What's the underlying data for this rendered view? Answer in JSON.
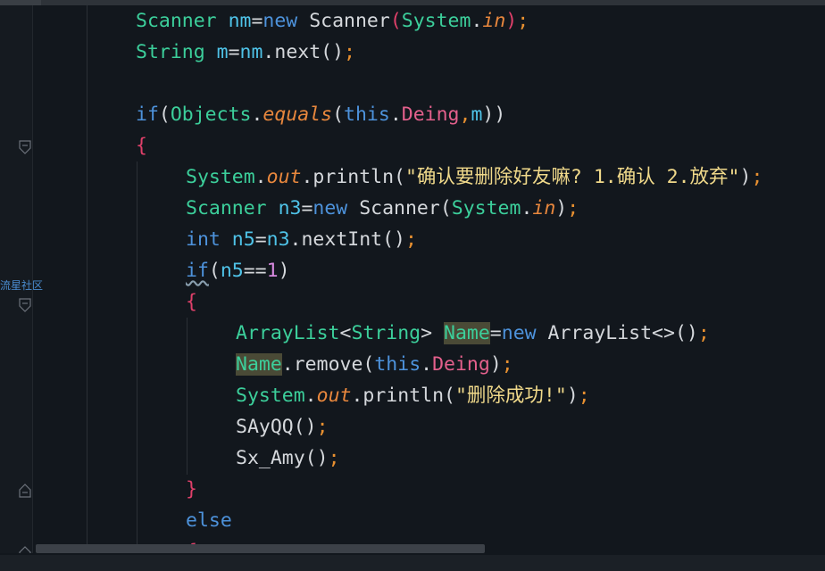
{
  "watermark": "流星社区",
  "code_lines": [
    [
      {
        "t": "    ",
        "c": "pn"
      },
      {
        "t": "Scanner",
        "c": "ty"
      },
      {
        "t": " ",
        "c": "pn"
      },
      {
        "t": "nm",
        "c": "var"
      },
      {
        "t": "=",
        "c": "pn"
      },
      {
        "t": "new",
        "c": "kw"
      },
      {
        "t": " ",
        "c": "pn"
      },
      {
        "t": "Scanner",
        "c": "pn"
      },
      {
        "t": "(",
        "c": "par1"
      },
      {
        "t": "System",
        "c": "ty"
      },
      {
        "t": ".",
        "c": "pn"
      },
      {
        "t": "in",
        "c": "st"
      },
      {
        "t": ")",
        "c": "par1"
      },
      {
        "t": ";",
        "c": "semi"
      }
    ],
    [
      {
        "t": "    ",
        "c": "pn"
      },
      {
        "t": "String",
        "c": "ty"
      },
      {
        "t": " ",
        "c": "pn"
      },
      {
        "t": "m",
        "c": "var"
      },
      {
        "t": "=",
        "c": "pn"
      },
      {
        "t": "nm",
        "c": "var"
      },
      {
        "t": ".",
        "c": "pn"
      },
      {
        "t": "next",
        "c": "pn"
      },
      {
        "t": "()",
        "c": "pn"
      },
      {
        "t": ";",
        "c": "semi"
      }
    ],
    [],
    [
      {
        "t": "    ",
        "c": "pn"
      },
      {
        "t": "if",
        "c": "kw"
      },
      {
        "t": "(",
        "c": "pn"
      },
      {
        "t": "Objects",
        "c": "ty"
      },
      {
        "t": ".",
        "c": "pn"
      },
      {
        "t": "equals",
        "c": "st"
      },
      {
        "t": "(",
        "c": "pn"
      },
      {
        "t": "this",
        "c": "kw"
      },
      {
        "t": ".",
        "c": "pn"
      },
      {
        "t": "Deing",
        "c": "fld"
      },
      {
        "t": ",",
        "c": "semi"
      },
      {
        "t": "m",
        "c": "var"
      },
      {
        "t": "))",
        "c": "pn"
      }
    ],
    [
      {
        "t": "    ",
        "c": "pn"
      },
      {
        "t": "{",
        "c": "brace"
      }
    ],
    [
      {
        "t": "        ",
        "c": "pn"
      },
      {
        "t": "System",
        "c": "ty"
      },
      {
        "t": ".",
        "c": "pn"
      },
      {
        "t": "out",
        "c": "st"
      },
      {
        "t": ".",
        "c": "pn"
      },
      {
        "t": "println",
        "c": "pn"
      },
      {
        "t": "(",
        "c": "pn"
      },
      {
        "t": "\"确认要删除好友嘛? 1.确认 2.放弃\"",
        "c": "str"
      },
      {
        "t": ")",
        "c": "pn"
      },
      {
        "t": ";",
        "c": "semi"
      }
    ],
    [
      {
        "t": "        ",
        "c": "pn"
      },
      {
        "t": "Scanner",
        "c": "ty"
      },
      {
        "t": " ",
        "c": "pn"
      },
      {
        "t": "n3",
        "c": "var"
      },
      {
        "t": "=",
        "c": "pn"
      },
      {
        "t": "new",
        "c": "kw"
      },
      {
        "t": " ",
        "c": "pn"
      },
      {
        "t": "Scanner",
        "c": "pn"
      },
      {
        "t": "(",
        "c": "pn"
      },
      {
        "t": "System",
        "c": "ty"
      },
      {
        "t": ".",
        "c": "pn"
      },
      {
        "t": "in",
        "c": "st"
      },
      {
        "t": ")",
        "c": "pn"
      },
      {
        "t": ";",
        "c": "semi"
      }
    ],
    [
      {
        "t": "        ",
        "c": "pn"
      },
      {
        "t": "int",
        "c": "kw"
      },
      {
        "t": " ",
        "c": "pn"
      },
      {
        "t": "n5",
        "c": "var"
      },
      {
        "t": "=",
        "c": "pn"
      },
      {
        "t": "n3",
        "c": "var"
      },
      {
        "t": ".",
        "c": "pn"
      },
      {
        "t": "nextInt",
        "c": "pn"
      },
      {
        "t": "()",
        "c": "pn"
      },
      {
        "t": ";",
        "c": "semi"
      }
    ],
    [
      {
        "t": "        ",
        "c": "pn"
      },
      {
        "t": "if",
        "c": "kw squig"
      },
      {
        "t": "(",
        "c": "pn"
      },
      {
        "t": "n5",
        "c": "var"
      },
      {
        "t": "==",
        "c": "pn"
      },
      {
        "t": "1",
        "c": "num"
      },
      {
        "t": ")",
        "c": "pn"
      }
    ],
    [
      {
        "t": "        ",
        "c": "pn"
      },
      {
        "t": "{",
        "c": "brace"
      }
    ],
    [
      {
        "t": "            ",
        "c": "pn"
      },
      {
        "t": "ArrayList",
        "c": "ty"
      },
      {
        "t": "<",
        "c": "pn"
      },
      {
        "t": "String",
        "c": "ty"
      },
      {
        "t": "> ",
        "c": "pn"
      },
      {
        "t": "Name",
        "c": "hl"
      },
      {
        "t": "=",
        "c": "pn"
      },
      {
        "t": "new",
        "c": "kw"
      },
      {
        "t": " ",
        "c": "pn"
      },
      {
        "t": "ArrayList",
        "c": "pn"
      },
      {
        "t": "<>",
        "c": "pn"
      },
      {
        "t": "()",
        "c": "pn"
      },
      {
        "t": ";",
        "c": "semi"
      }
    ],
    [
      {
        "t": "            ",
        "c": "pn"
      },
      {
        "t": "Name",
        "c": "hl"
      },
      {
        "t": ".",
        "c": "pn"
      },
      {
        "t": "remove",
        "c": "pn"
      },
      {
        "t": "(",
        "c": "pn"
      },
      {
        "t": "this",
        "c": "kw"
      },
      {
        "t": ".",
        "c": "pn"
      },
      {
        "t": "Deing",
        "c": "fld"
      },
      {
        "t": ")",
        "c": "pn"
      },
      {
        "t": ";",
        "c": "semi"
      }
    ],
    [
      {
        "t": "            ",
        "c": "pn"
      },
      {
        "t": "System",
        "c": "ty"
      },
      {
        "t": ".",
        "c": "pn"
      },
      {
        "t": "out",
        "c": "st"
      },
      {
        "t": ".",
        "c": "pn"
      },
      {
        "t": "println",
        "c": "pn"
      },
      {
        "t": "(",
        "c": "pn"
      },
      {
        "t": "\"删除成功!\"",
        "c": "str"
      },
      {
        "t": ")",
        "c": "pn"
      },
      {
        "t": ";",
        "c": "semi"
      }
    ],
    [
      {
        "t": "            ",
        "c": "pn"
      },
      {
        "t": "SAyQQ",
        "c": "pn"
      },
      {
        "t": "()",
        "c": "pn"
      },
      {
        "t": ";",
        "c": "semi"
      }
    ],
    [
      {
        "t": "            ",
        "c": "pn"
      },
      {
        "t": "Sx_Amy",
        "c": "pn"
      },
      {
        "t": "()",
        "c": "pn"
      },
      {
        "t": ";",
        "c": "semi"
      }
    ],
    [
      {
        "t": "        ",
        "c": "pn"
      },
      {
        "t": "}",
        "c": "brace"
      }
    ],
    [
      {
        "t": "        ",
        "c": "pn"
      },
      {
        "t": "else",
        "c": "kw"
      }
    ],
    [
      {
        "t": "        ",
        "c": "pn"
      },
      {
        "t": "{",
        "c": "brace"
      }
    ]
  ],
  "fold_markers": [
    "fold-open",
    "fold-open",
    "fold-close",
    "fold-close"
  ],
  "colors": {
    "background": "#12171d",
    "keyword": "#4d92db",
    "type": "#3ccf9b",
    "variable": "#4fc3e8",
    "field": "#e4608c",
    "static": "#e8873d",
    "string": "#f0d98a",
    "number": "#d88ae0",
    "brace": "#e0406a",
    "semicolon": "#e89030"
  }
}
